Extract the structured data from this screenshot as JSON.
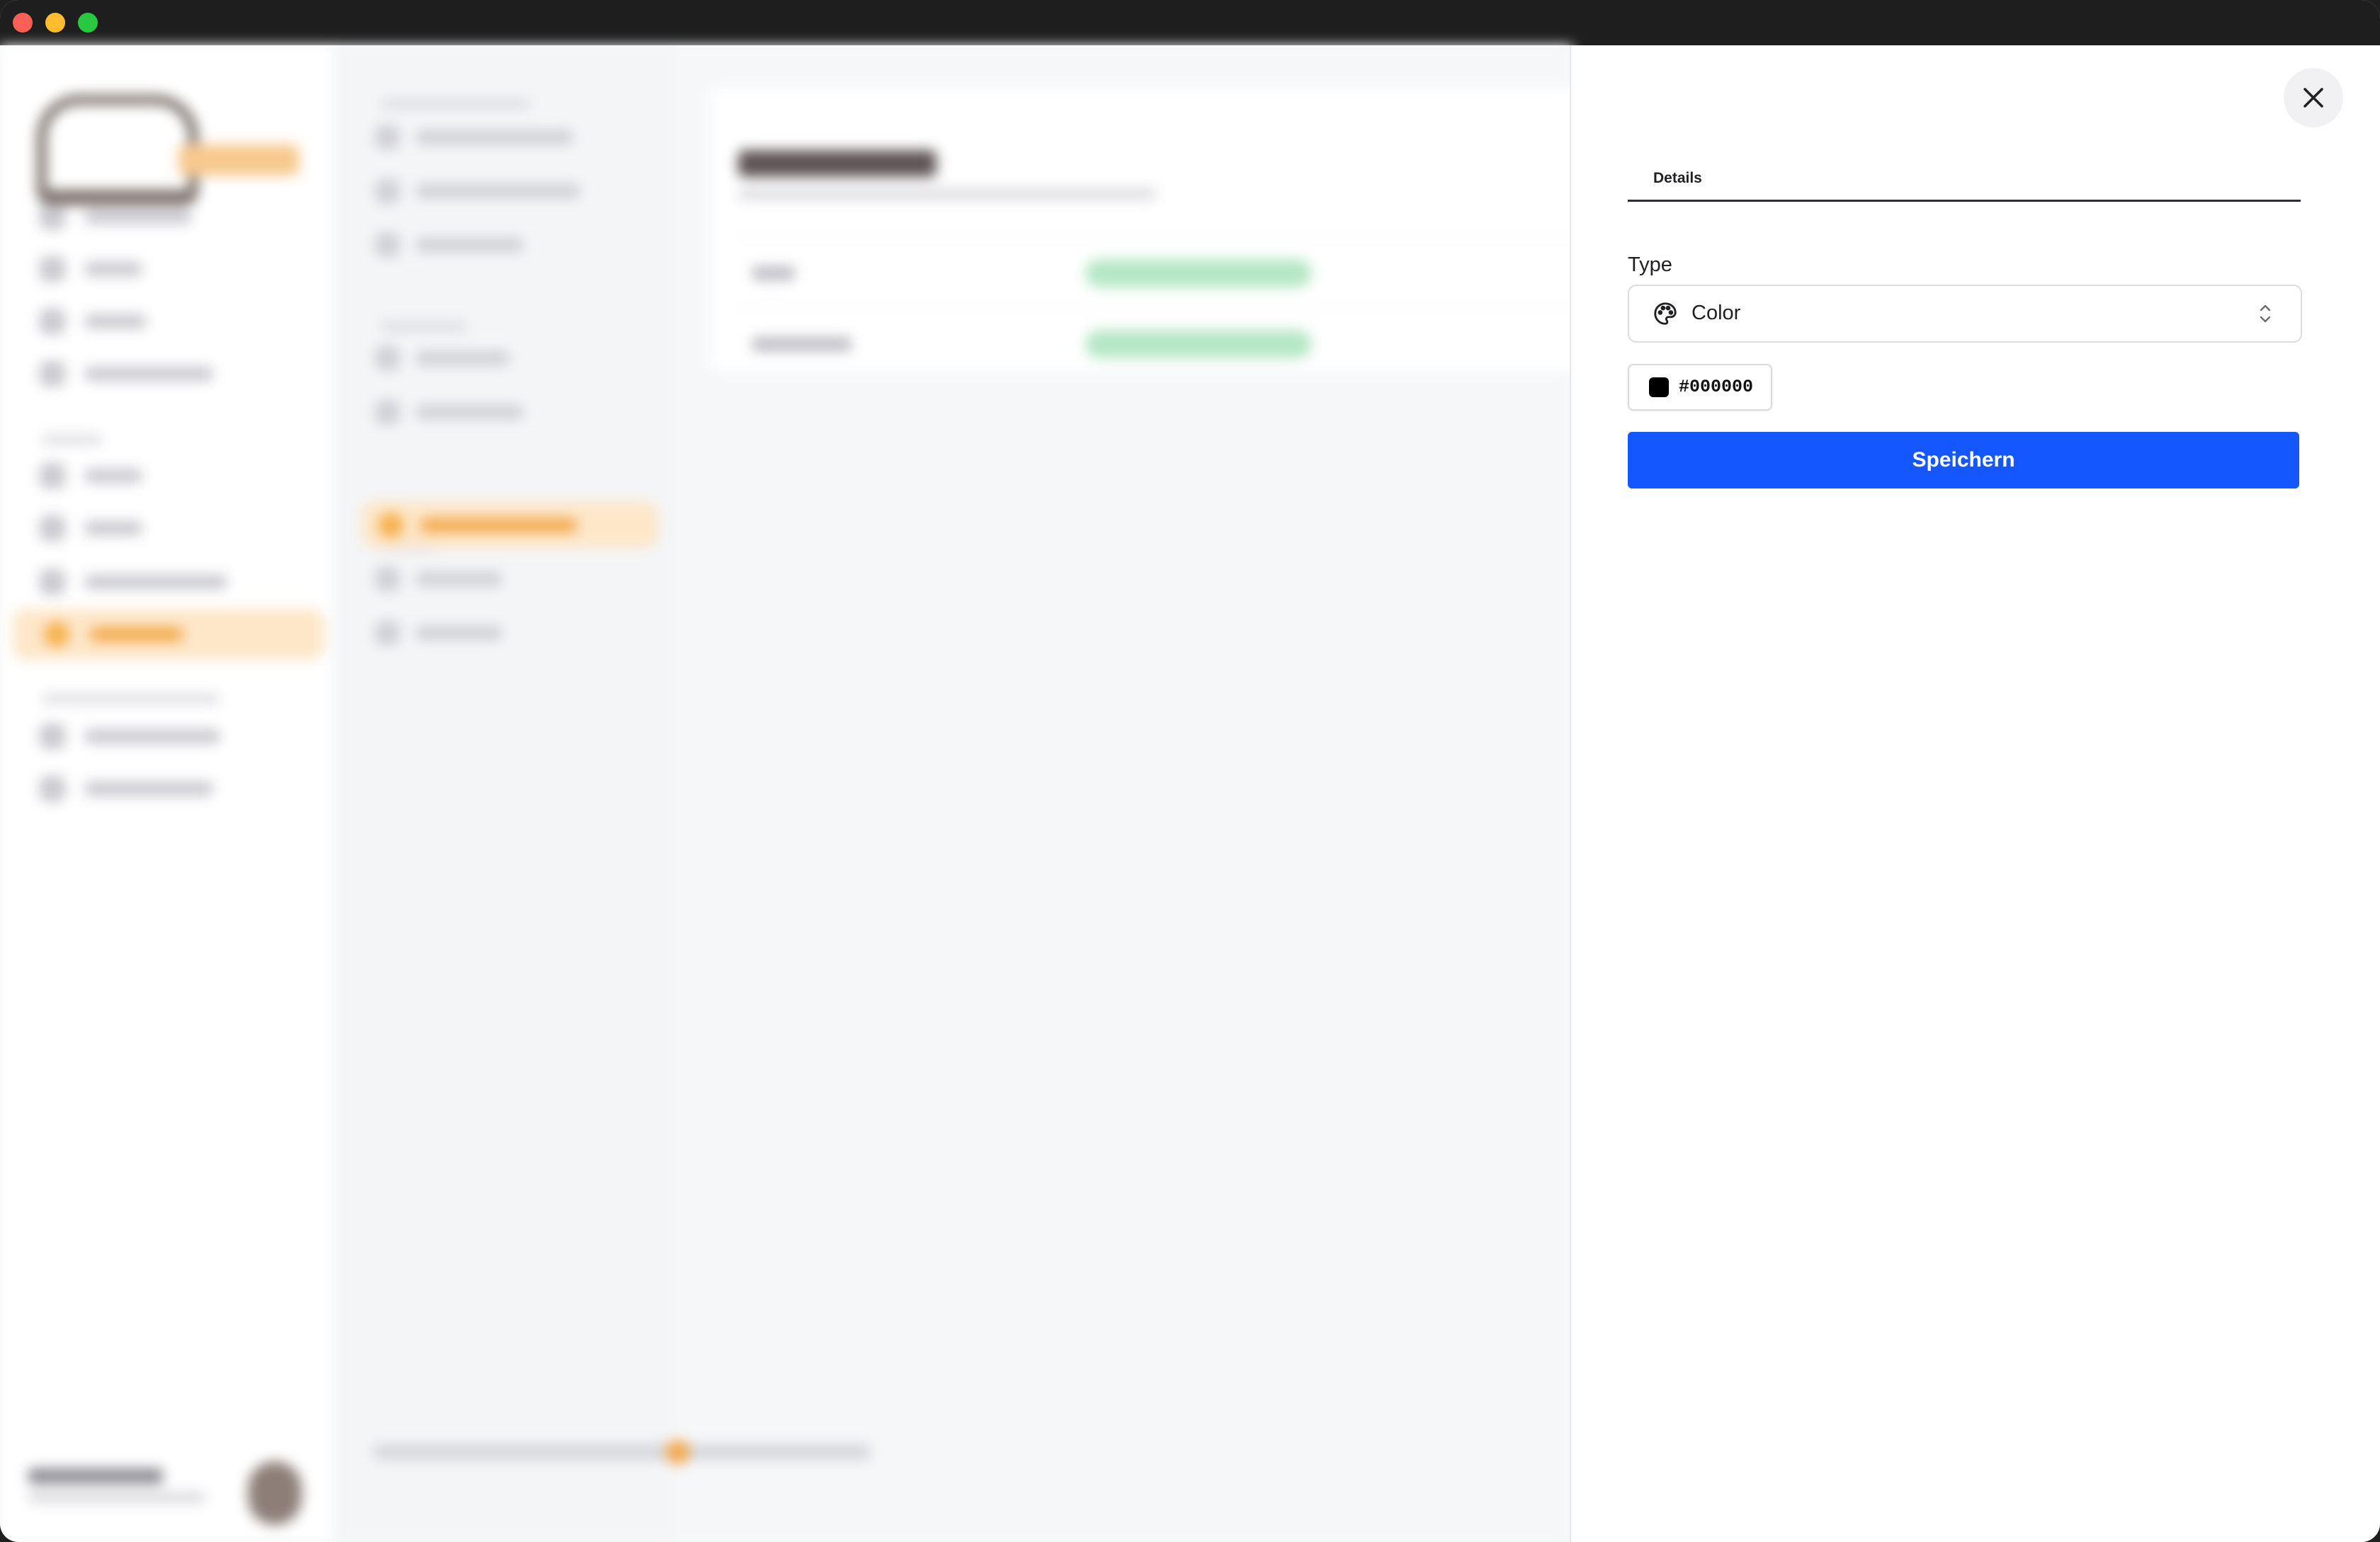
{
  "panel": {
    "tabs": [
      {
        "label": "Details"
      }
    ],
    "type_field": {
      "label": "Type",
      "value": "Color",
      "icon": "palette-icon"
    },
    "color": {
      "hex": "#000000",
      "swatch_color": "#000000"
    },
    "save_label": "Speichern",
    "close_icon": "close-icon"
  },
  "colors": {
    "primary_button": "#1557ff",
    "accent_active": "#f5b04b"
  }
}
